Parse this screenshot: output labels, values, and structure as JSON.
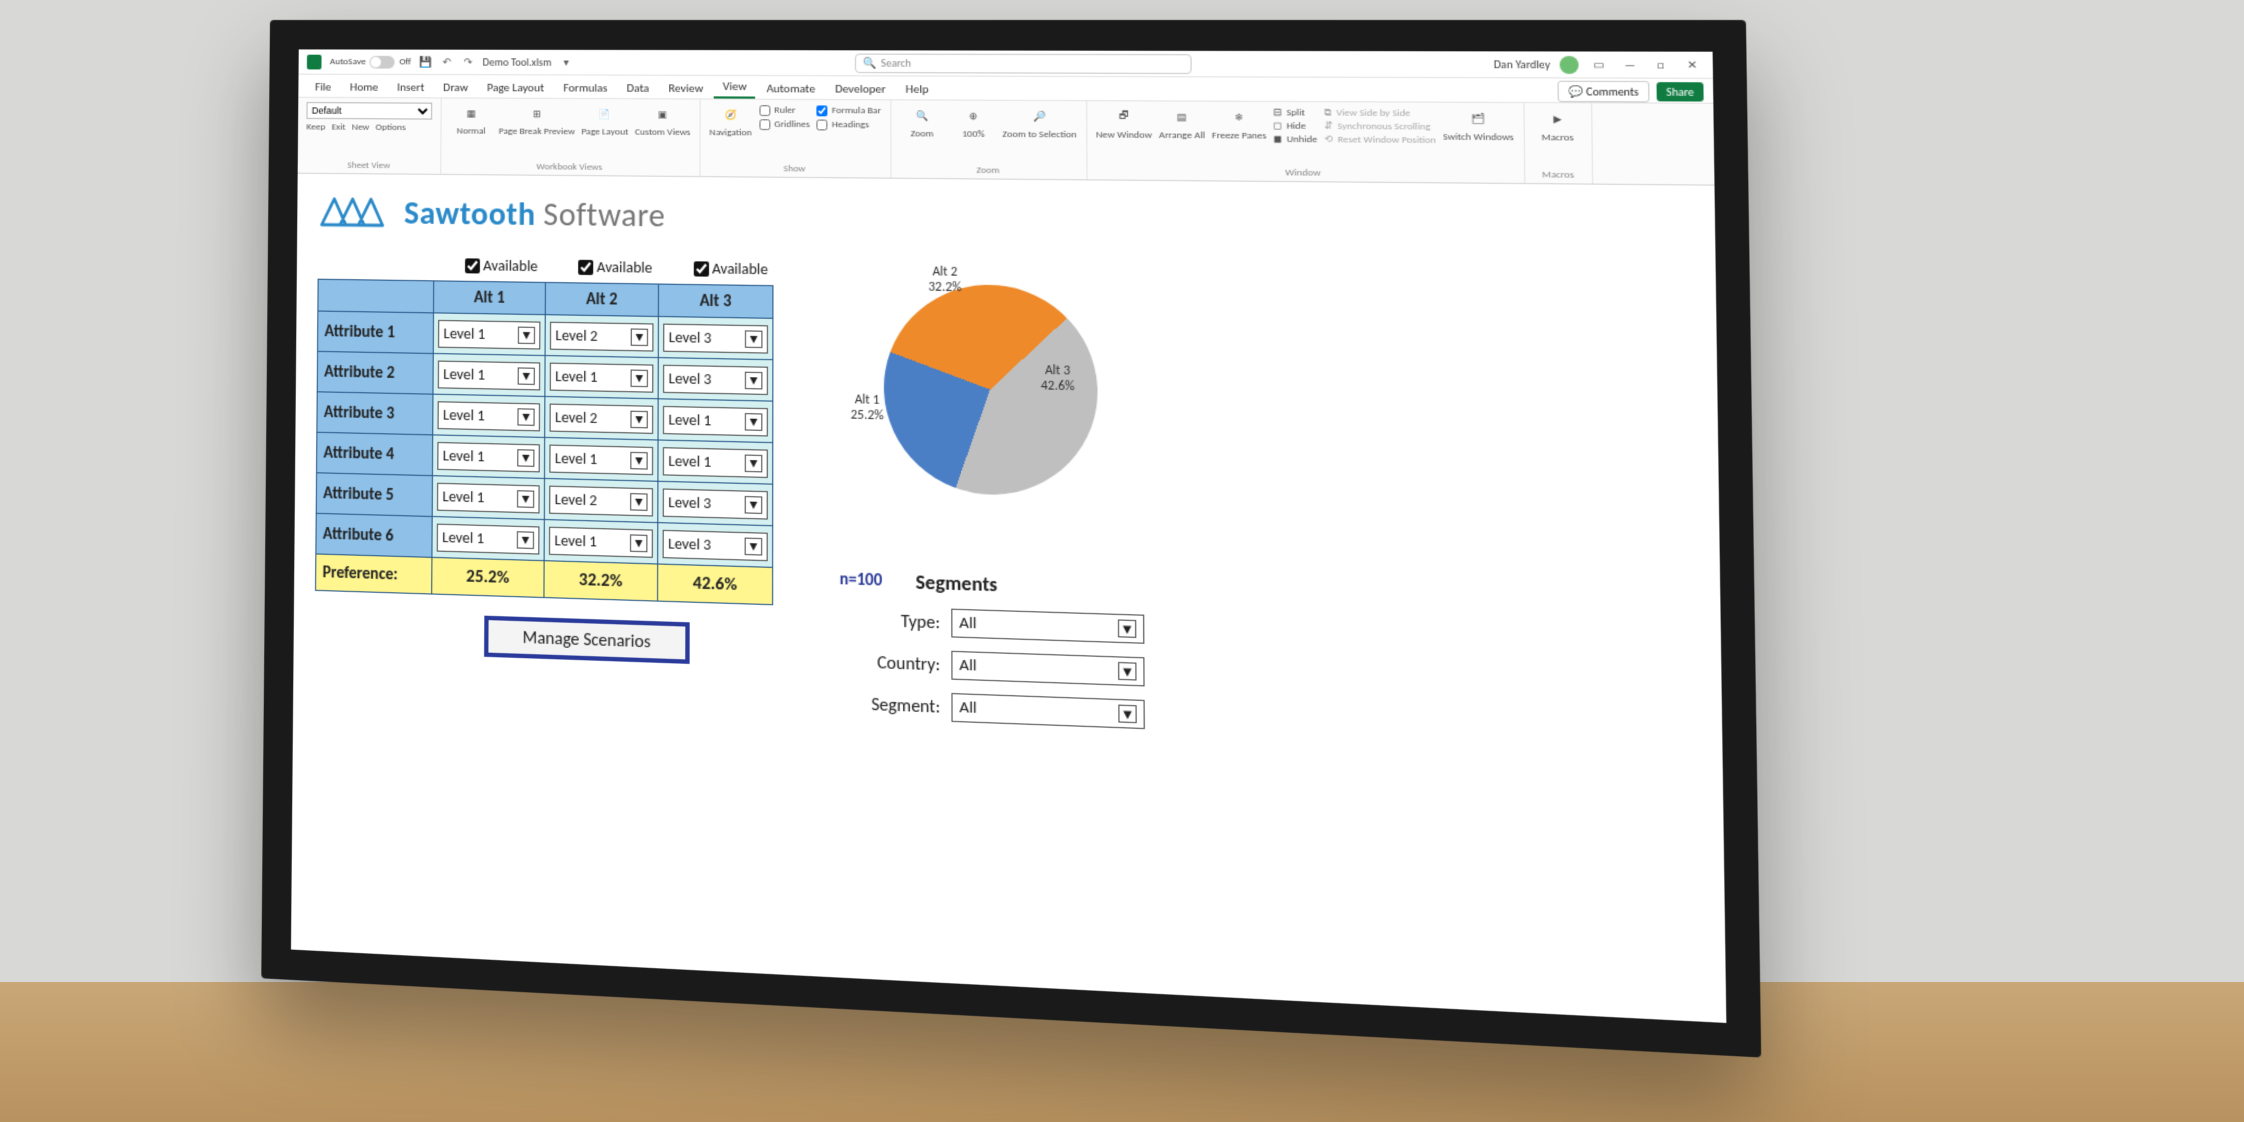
{
  "titlebar": {
    "autosave_label": "AutoSave",
    "autosave_state": "Off",
    "doc_name": "Demo Tool.xlsm",
    "search_placeholder": "Search",
    "user_name": "Dan Yardley"
  },
  "tabs": {
    "items": [
      "File",
      "Home",
      "Insert",
      "Draw",
      "Page Layout",
      "Formulas",
      "Data",
      "Review",
      "View",
      "Automate",
      "Developer",
      "Help"
    ],
    "active": "View",
    "comments": "Comments",
    "share": "Share"
  },
  "ribbon": {
    "sheetview": {
      "default_option": "Default",
      "keep": "Keep",
      "exit": "Exit",
      "new": "New",
      "options": "Options",
      "group": "Sheet View"
    },
    "workbookviews": {
      "normal": "Normal",
      "pagebreak": "Page Break Preview",
      "pagelayout": "Page Layout",
      "custom": "Custom Views",
      "group": "Workbook Views"
    },
    "show": {
      "navigation": "Navigation",
      "ruler": "Ruler",
      "formula": "Formula Bar",
      "gridlines": "Gridlines",
      "headings": "Headings",
      "group": "Show"
    },
    "zoom": {
      "zoom": "Zoom",
      "hundred": "100%",
      "selection": "Zoom to Selection",
      "group": "Zoom"
    },
    "window": {
      "new": "New Window",
      "arrange": "Arrange All",
      "freeze": "Freeze Panes",
      "split": "Split",
      "hide": "Hide",
      "unhide": "Unhide",
      "sidebyside": "View Side by Side",
      "syncscroll": "Synchronous Scrolling",
      "resetpos": "Reset Window Position",
      "switch": "Switch Windows",
      "group": "Window"
    },
    "macros": {
      "macros": "Macros",
      "group": "Macros"
    }
  },
  "brand": {
    "name1": "Sawtooth",
    "name2": "Software"
  },
  "simulator": {
    "available_label": "Available",
    "alts": [
      "Alt 1",
      "Alt 2",
      "Alt 3"
    ],
    "attributes": [
      "Attribute 1",
      "Attribute 2",
      "Attribute 3",
      "Attribute 4",
      "Attribute 5",
      "Attribute 6"
    ],
    "levels": [
      [
        "Level 1",
        "Level 2",
        "Level 3"
      ],
      [
        "Level 1",
        "Level 1",
        "Level 3"
      ],
      [
        "Level 1",
        "Level 2",
        "Level 1"
      ],
      [
        "Level 1",
        "Level 1",
        "Level 1"
      ],
      [
        "Level 1",
        "Level 2",
        "Level 3"
      ],
      [
        "Level 1",
        "Level 1",
        "Level 3"
      ]
    ],
    "preference_label": "Preference:",
    "preference": [
      "25.2%",
      "32.2%",
      "42.6%"
    ],
    "manage_button": "Manage Scenarios"
  },
  "segments": {
    "n_label": "n=100",
    "title": "Segments",
    "rows": [
      {
        "label": "Type:",
        "value": "All"
      },
      {
        "label": "Country:",
        "value": "All"
      },
      {
        "label": "Segment:",
        "value": "All"
      }
    ]
  },
  "chart_data": {
    "type": "pie",
    "title": "",
    "series": [
      {
        "name": "Alt 1",
        "value": 25.2
      },
      {
        "name": "Alt 2",
        "value": 32.2
      },
      {
        "name": "Alt 3",
        "value": 42.6
      }
    ],
    "labels": [
      {
        "name": "Alt 1",
        "text": "Alt 1\n25.2%"
      },
      {
        "name": "Alt 2",
        "text": "Alt 2\n32.2%"
      },
      {
        "name": "Alt 3",
        "text": "Alt 3\n42.6%"
      }
    ],
    "colors": {
      "Alt 1": "#4a7fc6",
      "Alt 2": "#ee8a2a",
      "Alt 3": "#bfbfbf"
    }
  }
}
